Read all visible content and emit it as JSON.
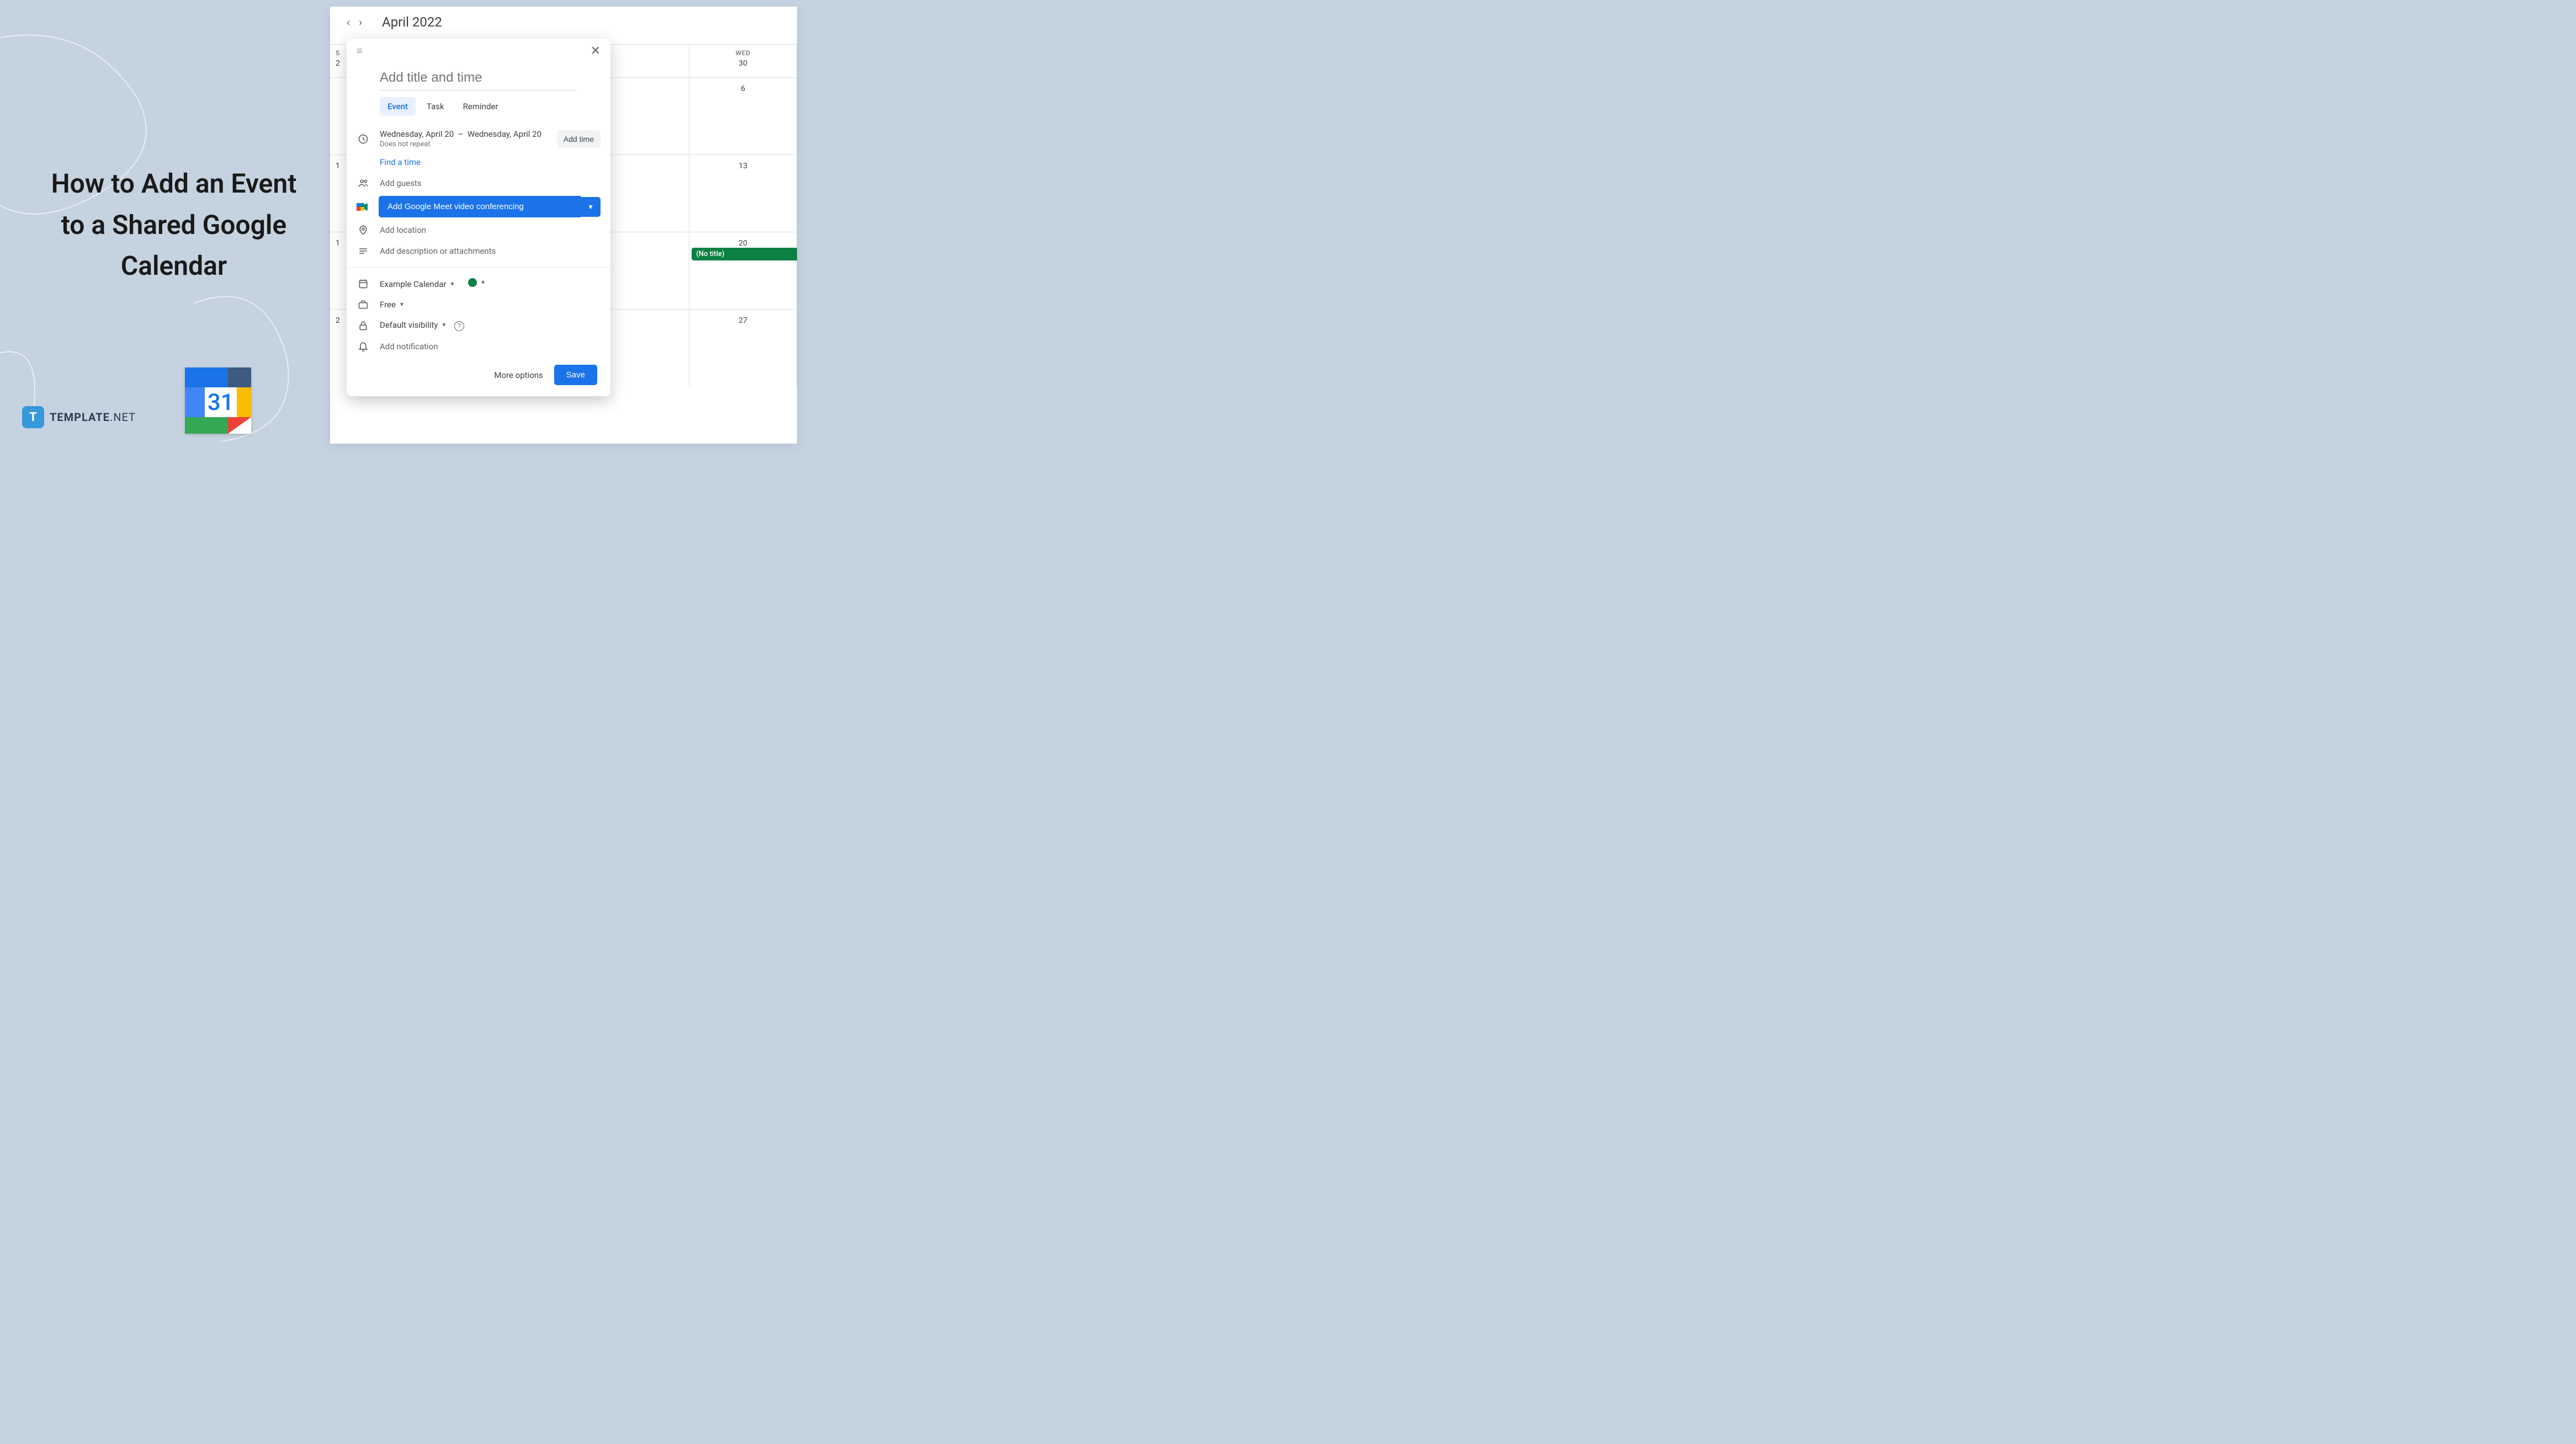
{
  "heading": "How to Add an Event to a Shared Google Calendar",
  "logo_text": "TEMPLATE",
  "logo_suffix": ".NET",
  "logo_badge": "T",
  "calendar_icon_number": "31",
  "calendar": {
    "month": "April 2022",
    "day_header_s": "S",
    "day_header_wed": "WED",
    "rows": [
      {
        "sun": "2",
        "wed": "30"
      },
      {
        "sun": "",
        "wed": "6"
      },
      {
        "sun": "1",
        "wed": "13"
      },
      {
        "sun": "1",
        "wed": "20",
        "event": "(No title)"
      },
      {
        "sun": "2",
        "wed": "27"
      }
    ]
  },
  "dialog": {
    "title_placeholder": "Add title and time",
    "tabs": {
      "event": "Event",
      "task": "Task",
      "reminder": "Reminder"
    },
    "date_start": "Wednesday, April 20",
    "date_sep": "–",
    "date_end": "Wednesday, April 20",
    "repeat": "Does not repeat",
    "add_time": "Add time",
    "find_time": "Find a time",
    "add_guests": "Add guests",
    "meet_btn": "Add Google Meet video conferencing",
    "add_location": "Add location",
    "add_desc": "Add description or attachments",
    "calendar_name": "Example Calendar",
    "busy_status": "Free",
    "visibility": "Default visibility",
    "add_notification": "Add notification",
    "more_options": "More options",
    "save": "Save"
  }
}
